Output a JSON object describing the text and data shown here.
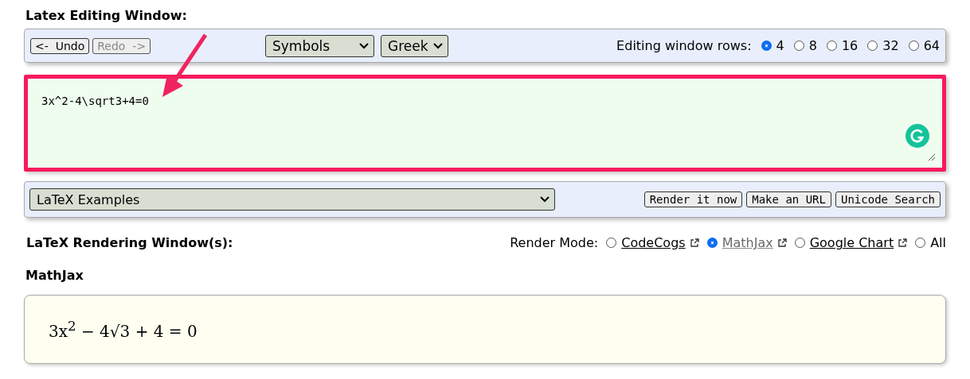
{
  "editing": {
    "title": "Latex Editing Window:",
    "undo": {
      "label": "<-  Undo",
      "disabled": false
    },
    "redo": {
      "label": "Redo  ->",
      "disabled": true
    },
    "dropdowns": [
      {
        "value": "Symbols"
      },
      {
        "value": "Greek"
      }
    ],
    "rows_label": "Editing window rows:",
    "rows": [
      {
        "label": "4",
        "selected": true
      },
      {
        "label": "8",
        "selected": false
      },
      {
        "label": "16",
        "selected": false
      },
      {
        "label": "32",
        "selected": false
      },
      {
        "label": "64",
        "selected": false
      }
    ],
    "editor": {
      "value": "3x^2-4\\sqrt3+4=0"
    },
    "examples": {
      "value": "LaTeX Examples"
    },
    "buttons": [
      "Render it now",
      "Make an URL",
      "Unicode Search"
    ]
  },
  "rendering": {
    "title": "LaTeX Rendering Window(s):",
    "mode_label": "Render Mode:",
    "modes": [
      {
        "label": "CodeCogs",
        "kind": "link",
        "visited": false,
        "selected": false
      },
      {
        "label": "MathJax",
        "kind": "link",
        "visited": true,
        "selected": true
      },
      {
        "label": "Google Chart",
        "kind": "link",
        "visited": false,
        "selected": false
      },
      {
        "label": "All",
        "kind": "plain",
        "selected": false
      }
    ],
    "panel_title": "MathJax",
    "formula": "3x$^{2}$ − 4√3 + 4 = 0"
  }
}
